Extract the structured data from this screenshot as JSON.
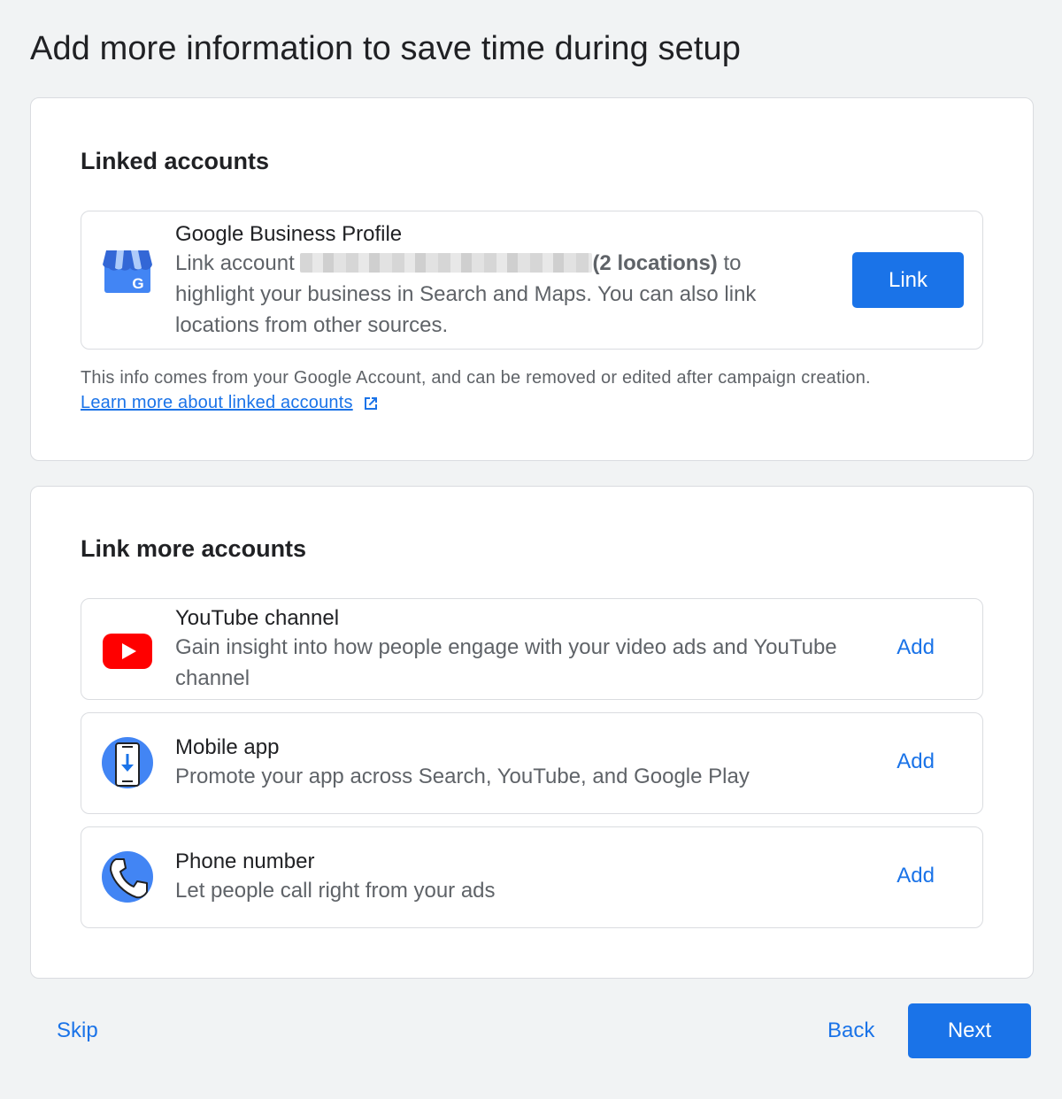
{
  "page": {
    "title": "Add more information to save time during setup"
  },
  "linked_accounts": {
    "title": "Linked accounts",
    "gbp": {
      "icon": "google-business-profile-icon",
      "title": "Google Business Profile",
      "desc_prefix": "Link account",
      "desc_bold": "(2 locations)",
      "desc_suffix": "to highlight your business in Search and Maps. You can also link locations from other sources.",
      "button": "Link"
    },
    "info_text": "This info comes from your Google Account, and can be removed or edited after campaign creation.",
    "learn_more": "Learn more about linked accounts"
  },
  "link_more": {
    "title": "Link more accounts",
    "items": [
      {
        "icon": "youtube-icon",
        "title": "YouTube channel",
        "desc": "Gain insight into how people engage with your video ads and YouTube channel",
        "button": "Add"
      },
      {
        "icon": "mobile-app-icon",
        "title": "Mobile app",
        "desc": "Promote your app across Search, YouTube, and Google Play",
        "button": "Add"
      },
      {
        "icon": "phone-icon",
        "title": "Phone number",
        "desc": "Let people call right from your ads",
        "button": "Add"
      }
    ]
  },
  "footer": {
    "skip": "Skip",
    "back": "Back",
    "next": "Next"
  },
  "colors": {
    "accent": "#1a73e8",
    "background": "#f1f3f4",
    "youtube_red": "#ff0000"
  }
}
